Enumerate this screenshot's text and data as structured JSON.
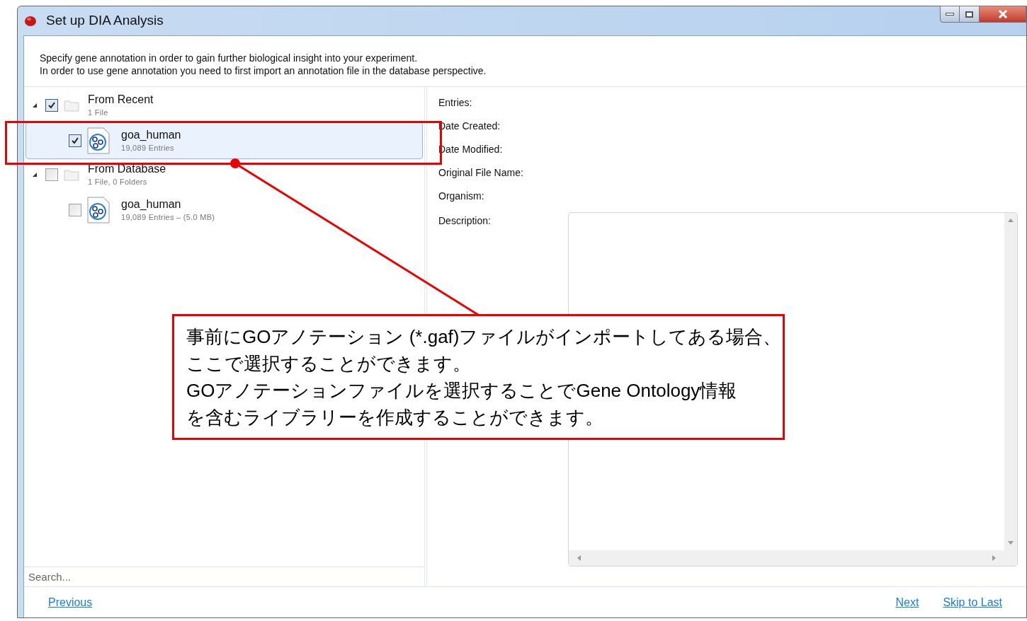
{
  "window": {
    "title": "Set up DIA Analysis"
  },
  "intro": [
    "Specify gene annotation in order to gain further biological insight into your experiment.",
    "In order to use gene annotation you need to first import an annotation file in the database perspective."
  ],
  "tree": [
    {
      "label": "From Recent",
      "sublabel": "1 File",
      "expanded": true,
      "checked": true,
      "children": [
        {
          "name": "goa_human",
          "detail": "19,089 Entries",
          "checked": true,
          "selected": true
        }
      ]
    },
    {
      "label": "From Database",
      "sublabel": "1 File, 0 Folders",
      "expanded": true,
      "checked": false,
      "children": [
        {
          "name": "goa_human",
          "detail": "19,089 Entries – (5.0 MB)",
          "checked": false,
          "selected": false
        }
      ]
    }
  ],
  "search": {
    "placeholder": "Search..."
  },
  "details": [
    "Entries:",
    "Date Created:",
    "Date Modified:",
    "Original File Name:",
    "Organism:"
  ],
  "description_label": "Description:",
  "nav": {
    "previous": "Previous",
    "next": "Next",
    "skip": "Skip to Last"
  },
  "annotation": {
    "lines": [
      "事前にGOアノテーション (*.gaf)ファイルがインポートしてある場合、",
      "ここで選択することができます。",
      "GOアノテーションファイルを選択することでGene Ontology情報",
      "を含むライブラリーを作成することができます。"
    ]
  }
}
